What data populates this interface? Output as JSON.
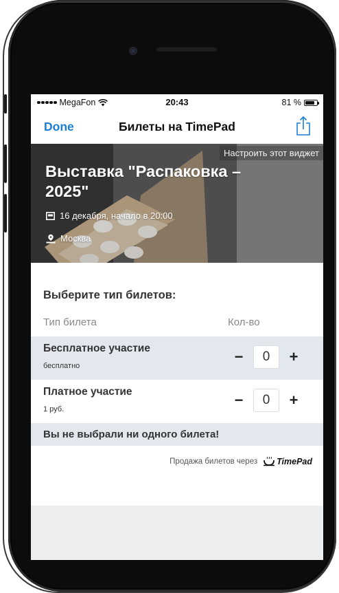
{
  "status_bar": {
    "carrier": "MegaFon",
    "time": "20:43",
    "battery_text": "81 %",
    "battery_level": 0.81
  },
  "nav": {
    "done_label": "Done",
    "title": "Билеты на TimePad",
    "share_icon": "share-icon"
  },
  "event": {
    "customize_label": "Настроить этот виджет",
    "title": "Выставка \"Распаковка – 2025\"",
    "date_text": "16 декабря, начало в 20:00",
    "location": "Москва"
  },
  "tickets": {
    "heading": "Выберите тип билетов:",
    "col_type": "Тип билета",
    "col_qty": "Кол-во",
    "items": [
      {
        "name": "Бесплатное участие",
        "price": "бесплатно",
        "qty": "0"
      },
      {
        "name": "Платное участие",
        "price": "1 руб.",
        "qty": "0"
      }
    ],
    "minus": "−",
    "plus": "+",
    "notice": "Вы не выбрали ни одного билета!"
  },
  "footer": {
    "sold_via": "Продажа билетов через",
    "brand": "TimePad"
  },
  "colors": {
    "accent": "#1d7ed6",
    "row_alt": "#e3e8ee",
    "screen_bg": "#eceef0"
  }
}
